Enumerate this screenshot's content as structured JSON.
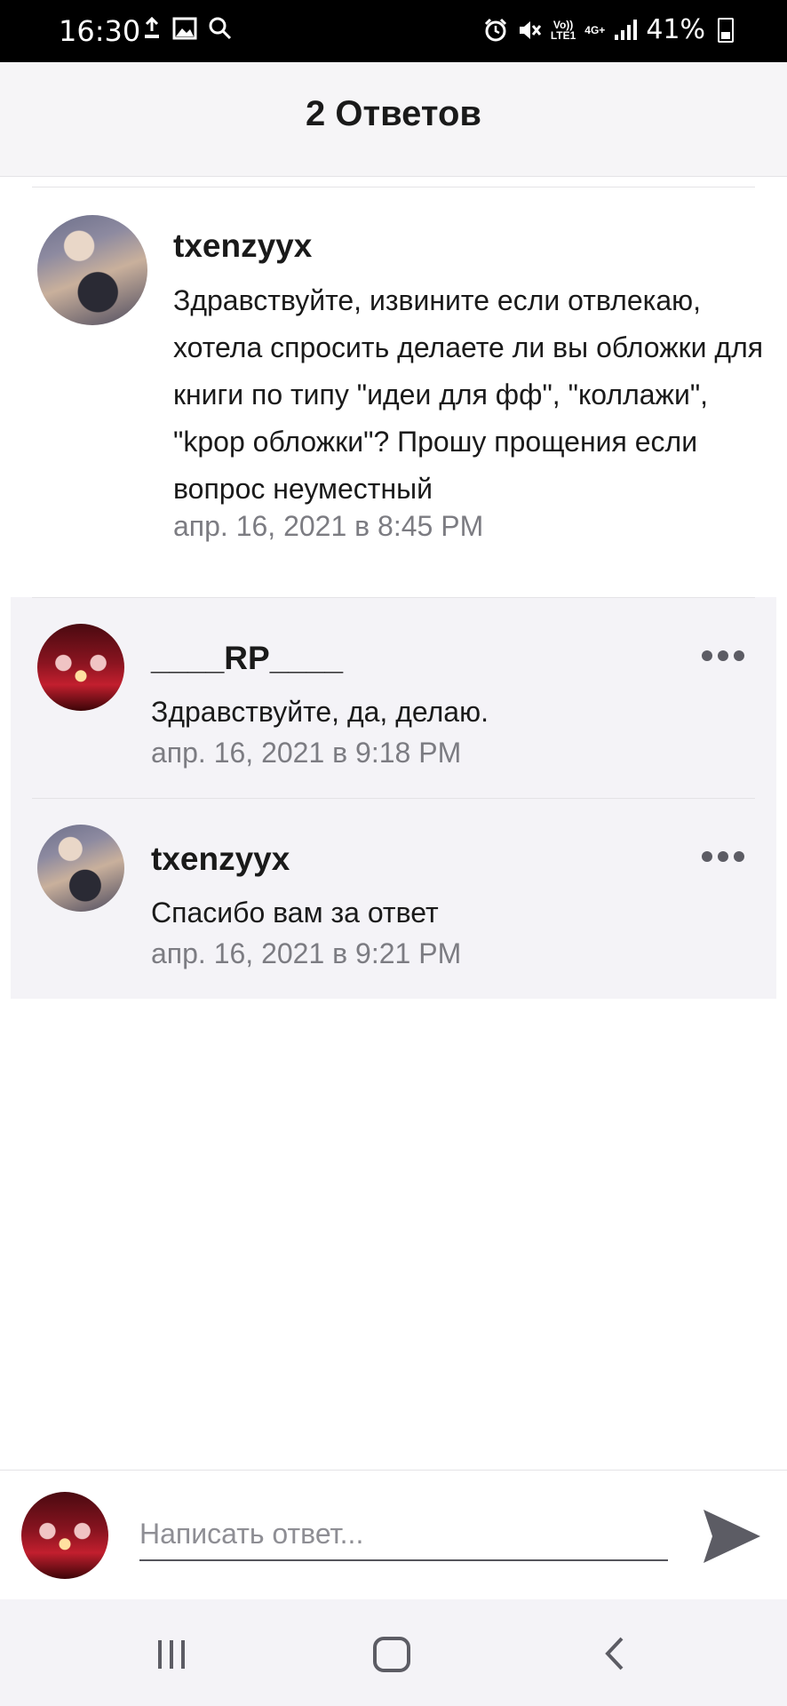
{
  "status_bar": {
    "time": "16:30",
    "network": "Vo))\nLTE1",
    "network_type": "4G+",
    "battery": "41%",
    "left_icons": [
      "upload-icon",
      "image-icon",
      "search-icon"
    ],
    "right_icons": [
      "alarm-icon",
      "mute-icon",
      "signal-icon",
      "battery-icon"
    ]
  },
  "header": {
    "title": "2 Ответов"
  },
  "original_comment": {
    "username": "txenzyyx",
    "text": "Здравствуйте, извините если отвлекаю, хотела спросить делаете ли вы обложки для книги по типу \"идеи для фф\", \"коллажи\", \"kpop обложки\"? Прошу прощения если вопрос неуместный",
    "date": "апр. 16, 2021 в 8:45 PM"
  },
  "replies": [
    {
      "username": "____RP____",
      "text": "Здравствуйте, да, делаю.",
      "date": "апр. 16, 2021 в 9:18 PM"
    },
    {
      "username": "txenzyyx",
      "text": "Спасибо вам за ответ",
      "date": "апр. 16, 2021 в 9:21 PM"
    }
  ],
  "composer": {
    "placeholder": "Написать ответ..."
  },
  "colors": {
    "header_bg": "#f6f5f7",
    "reply_bg": "#f4f3f7",
    "muted_text": "#7c7c82",
    "icon_gray": "#5c5c64"
  }
}
